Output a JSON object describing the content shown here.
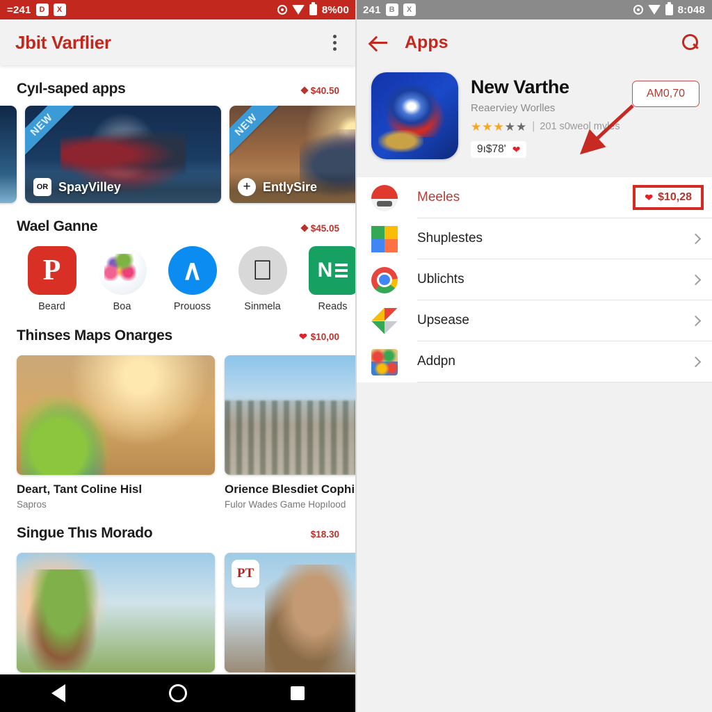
{
  "left": {
    "status_bar": {
      "left_text": "=241",
      "chip1": "D",
      "chip2": "X",
      "time": "8%00"
    },
    "appbar": {
      "title": "Jbit Varflier",
      "menu_icon": "kebab-menu-icon"
    },
    "sections": [
      {
        "title": "Cyıl-saped apps",
        "price": "$40.50",
        "price_icon": "diamond",
        "banners": [
          {
            "flag": "",
            "badge": "",
            "label": ""
          },
          {
            "flag": "NEW",
            "badge": "OR",
            "label": "SpayVilley"
          },
          {
            "flag": "NEW",
            "badge": "+",
            "label": "EntlySire"
          }
        ]
      },
      {
        "title": "Wael Ganne",
        "price": "$45.05",
        "price_icon": "diamond",
        "apps": [
          {
            "label": "Beard",
            "icon": "pocket-icon",
            "glyph": "P"
          },
          {
            "label": "Boa",
            "icon": "photos-ball-icon",
            "glyph": ""
          },
          {
            "label": "Prouoss",
            "icon": "messenger-icon",
            "glyph": "A̵"
          },
          {
            "label": "Sinmela",
            "icon": "apple-icon",
            "glyph": "⌘"
          },
          {
            "label": "Reads",
            "icon": "onenote-icon",
            "glyph": "N"
          }
        ]
      },
      {
        "title": "Thinses Maps Onarges",
        "price": "$10,00",
        "price_icon": "heart",
        "cards": [
          {
            "title": "Deart, Tant Coline Hisl",
            "subtitle": "Sapros",
            "tag": ""
          },
          {
            "title": "Orience Blesdiet Cophi",
            "subtitle": "Fulor Wades Game Hopılood",
            "tag": ""
          }
        ]
      },
      {
        "title": "Singue Thıs Morado",
        "price": "$18.30",
        "price_icon": "none",
        "cards": [
          {
            "title": "",
            "subtitle": "",
            "tag": ""
          },
          {
            "title": "",
            "subtitle": "",
            "tag": "PT"
          }
        ]
      }
    ],
    "navbar": {
      "back": "back-triangle-icon",
      "home": "home-circle-icon",
      "recents": "recents-square-icon"
    }
  },
  "right": {
    "status_bar": {
      "left_text": "241",
      "chip1": "B",
      "chip2": "X",
      "time": "8:048"
    },
    "appbar": {
      "title": "Apps",
      "back_icon": "back-arrow-icon",
      "search_icon": "search-icon"
    },
    "hero": {
      "name": "New Varthe",
      "developer": "Reaerviey Worlles",
      "stars_on": 3,
      "stars_total": 5,
      "rating_count": "201 s0weol myles",
      "downloads": "9ı$78'",
      "heart": "❤",
      "price_badge": "AM0,70"
    },
    "list": [
      {
        "label": "Meeles",
        "icon": "mario-icon",
        "trailing": "price",
        "price": "$10,28",
        "highlight": true
      },
      {
        "label": "Shuplestes",
        "icon": "windows-icon",
        "trailing": "chevron",
        "price": "",
        "highlight": false
      },
      {
        "label": "Ublichts",
        "icon": "chrome-icon",
        "trailing": "chevron",
        "price": "",
        "highlight": false
      },
      {
        "label": "Upsease",
        "icon": "gphotos-icon",
        "trailing": "chevron",
        "price": "",
        "highlight": false
      },
      {
        "label": "Addpn",
        "icon": "toys-icon",
        "trailing": "chevron",
        "price": "",
        "highlight": false
      }
    ]
  },
  "colors": {
    "brand_red": "#c3281f",
    "accent_red": "#b8342c",
    "highlight_box": "#d32a22",
    "status_right": "#8a8a8a"
  }
}
